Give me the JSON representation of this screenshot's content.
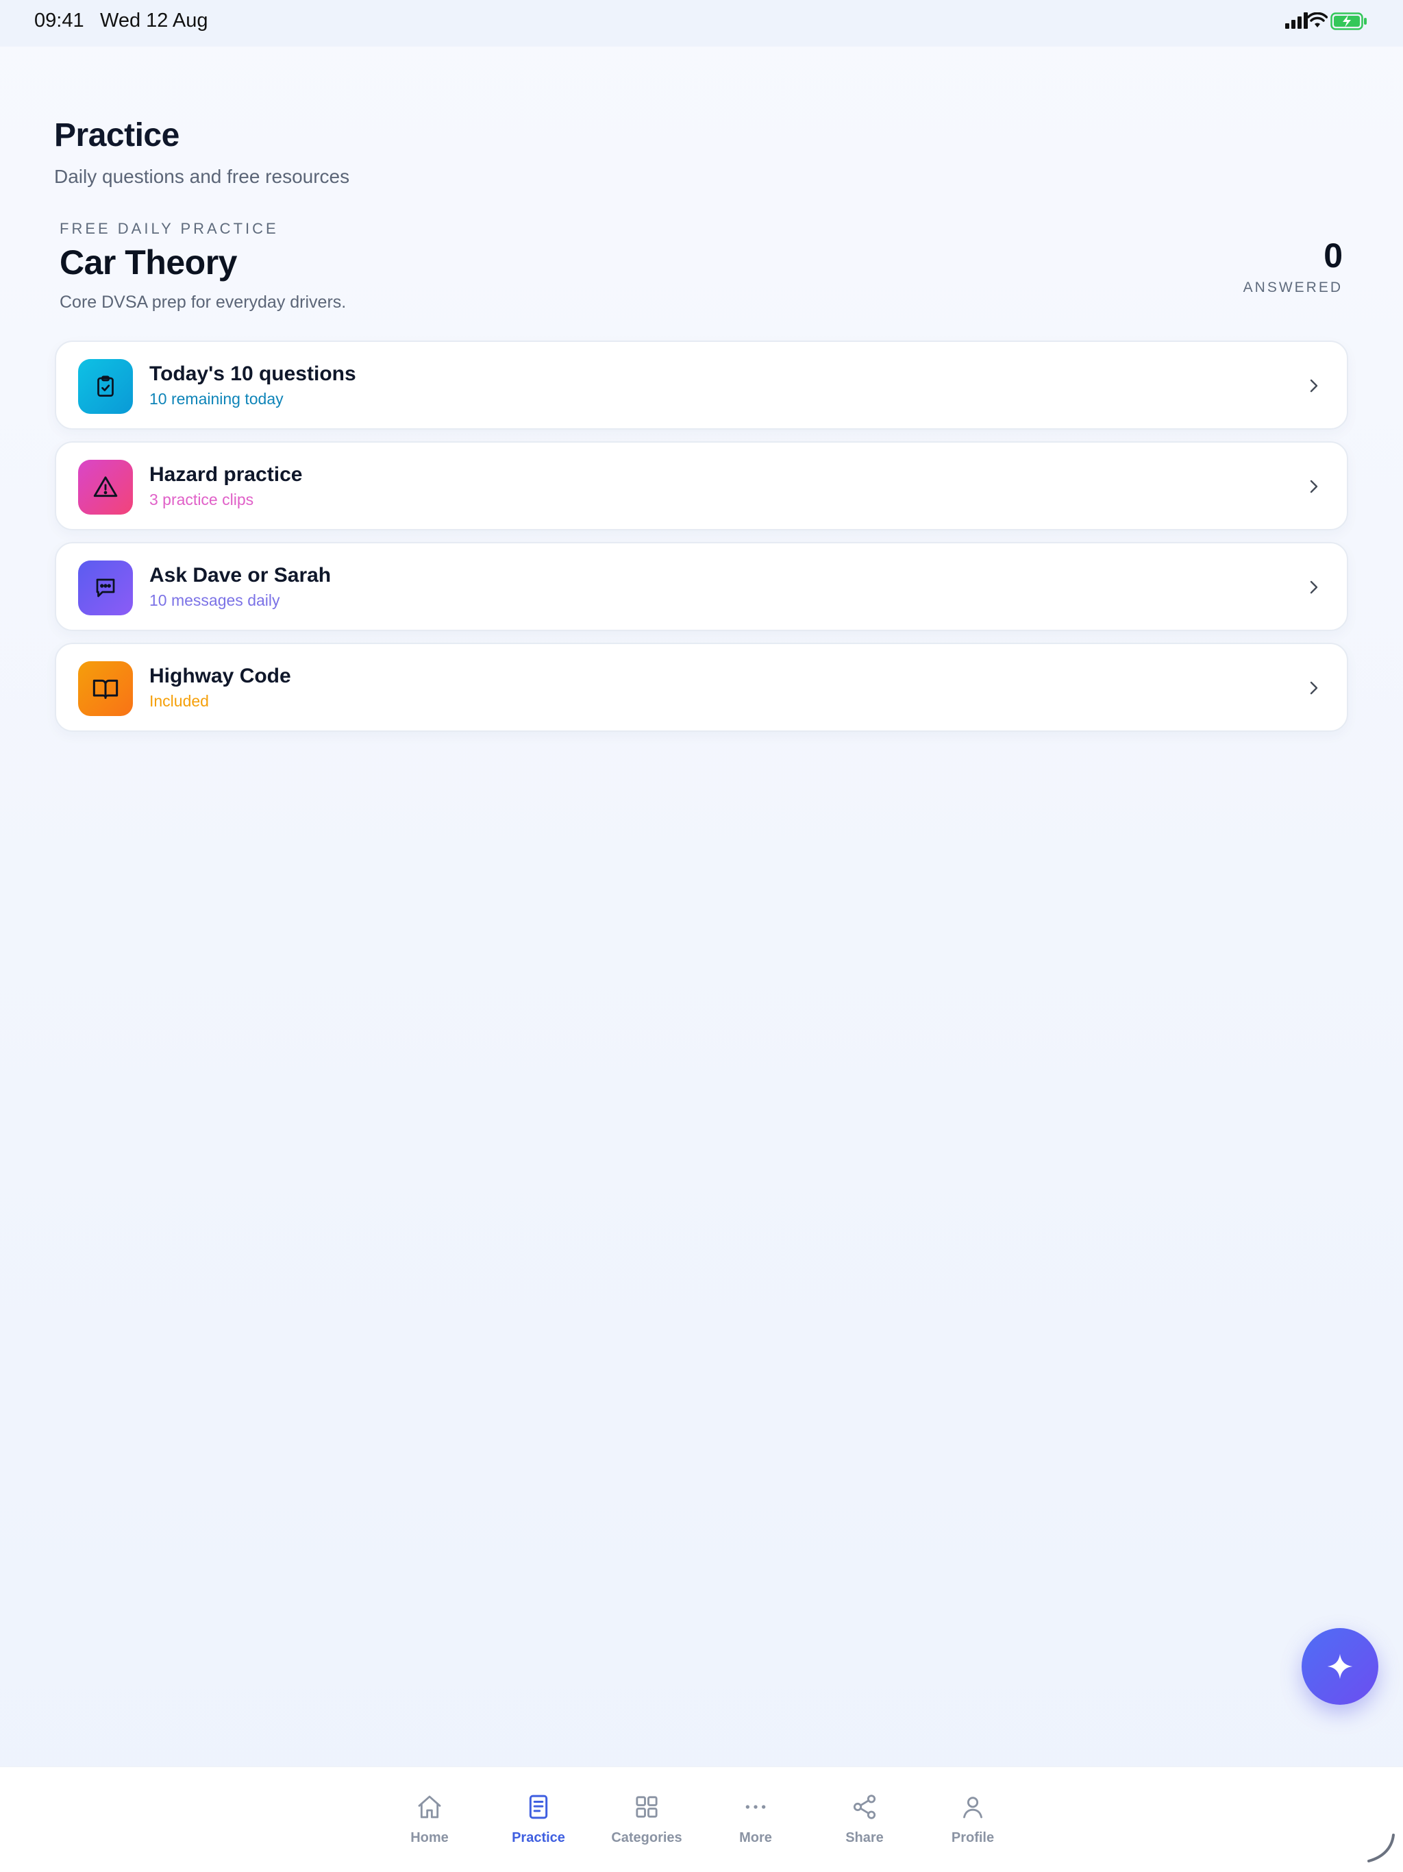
{
  "status_bar": {
    "time": "09:41",
    "date": "Wed 12 Aug",
    "icons": [
      "signal-icon",
      "wifi-icon",
      "battery-charging-icon"
    ]
  },
  "header": {
    "title": "Practice",
    "subtitle": "Daily questions and free resources"
  },
  "section": {
    "eyebrow": "FREE DAILY PRACTICE",
    "title": "Car Theory",
    "description": "Core DVSA prep for everyday drivers.",
    "answered_count": "0",
    "answered_label": "ANSWERED"
  },
  "cards": [
    {
      "title": "Today's 10 questions",
      "subtitle": "10 remaining today",
      "icon": "clipboard-check-icon",
      "accent": "#0ea5d8",
      "subtitle_color": "#0e84b8"
    },
    {
      "title": "Hazard practice",
      "subtitle": "3 practice clips",
      "icon": "warning-triangle-icon",
      "accent": "#e83e8c",
      "subtitle_color": "#e060c8"
    },
    {
      "title": "Ask Dave or Sarah",
      "subtitle": "10 messages daily",
      "icon": "chat-bubble-icon",
      "accent": "#6b5cf0",
      "subtitle_color": "#7b72e6"
    },
    {
      "title": "Highway Code",
      "subtitle": "Included",
      "icon": "open-book-icon",
      "accent": "#f7861a",
      "subtitle_color": "#f5a00a"
    }
  ],
  "fab": {
    "icon": "sparkle-icon"
  },
  "tabs": [
    {
      "label": "Home",
      "icon": "home-icon",
      "active": false
    },
    {
      "label": "Practice",
      "icon": "document-icon",
      "active": true
    },
    {
      "label": "Categories",
      "icon": "grid-icon",
      "active": false
    },
    {
      "label": "More",
      "icon": "more-dots-icon",
      "active": false
    },
    {
      "label": "Share",
      "icon": "share-icon",
      "active": false
    },
    {
      "label": "Profile",
      "icon": "person-icon",
      "active": false
    }
  ],
  "colors": {
    "primary": "#4b6cf0",
    "tab_inactive": "#8a93a3",
    "background": "#f3f6fd"
  }
}
